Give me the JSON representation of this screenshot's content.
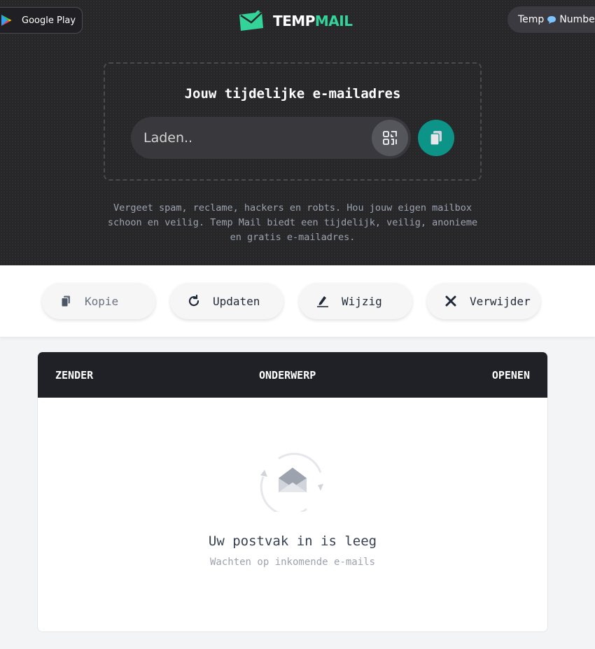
{
  "header": {
    "google_play_label": "Google Play",
    "logo": {
      "part1": "TEMP",
      "part2": "MAIL",
      "icon": "envelope-check-icon"
    },
    "temp_number": {
      "before": "Temp",
      "icon": "speech-bubble-icon",
      "after": "Numbe"
    }
  },
  "hero": {
    "title": "Jouw tijdelijke e-mailadres",
    "email_placeholder": "Laden..",
    "email_value": "",
    "tagline": "Vergeet spam, reclame, hackers en robts. Hou jouw eigen mailbox schoon en veilig. Temp Mail biedt een tijdelijk, veilig, anonieme en gratis e-mailadres."
  },
  "actions": [
    {
      "label": "Kopie",
      "icon": "copy-icon",
      "enabled": false
    },
    {
      "label": "Updaten",
      "icon": "refresh-icon",
      "enabled": true
    },
    {
      "label": "Wijzig",
      "icon": "edit-icon",
      "enabled": true
    },
    {
      "label": "Verwijder",
      "icon": "close-icon",
      "enabled": true
    }
  ],
  "inbox": {
    "columns": [
      "ZENDER",
      "ONDERWERP",
      "OPENEN"
    ],
    "empty_title": "Uw postvak in is leeg",
    "empty_subtitle": "Wachten op inkomende e-mails"
  },
  "colors": {
    "brand_green": "#34d399",
    "copy_button": "#0d9488",
    "hero_bg": "#27272a",
    "table_header": "#202127"
  }
}
